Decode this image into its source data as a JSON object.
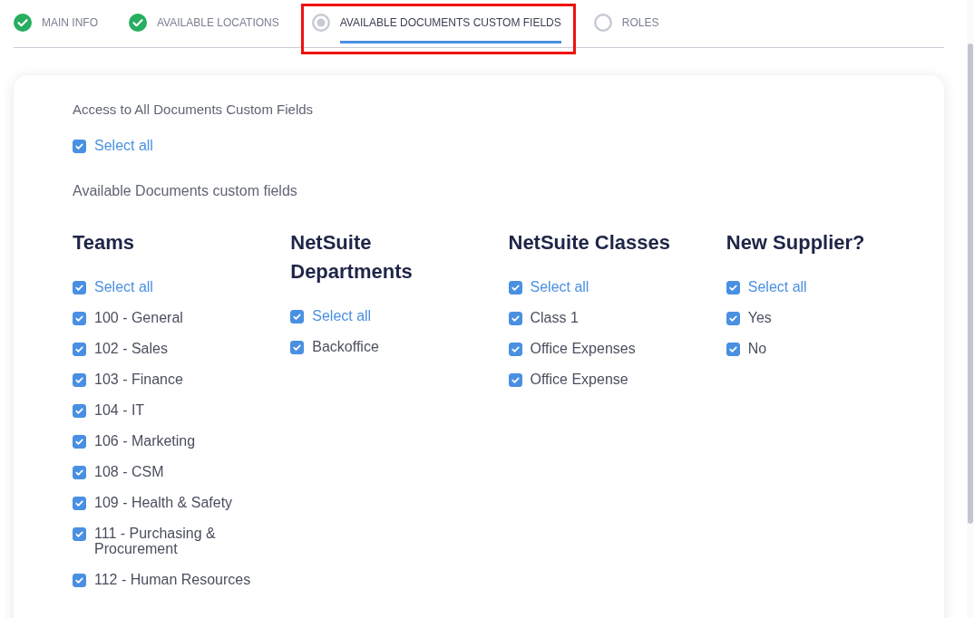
{
  "steps": [
    {
      "label": "MAIN INFO",
      "kind": "done",
      "selected": false,
      "highlighted": false
    },
    {
      "label": "AVAILABLE LOCATIONS",
      "kind": "done",
      "selected": false,
      "highlighted": false
    },
    {
      "label": "AVAILABLE DOCUMENTS CUSTOM FIELDS",
      "kind": "current",
      "selected": true,
      "highlighted": true
    },
    {
      "label": "ROLES",
      "kind": "pending",
      "selected": false,
      "highlighted": false
    }
  ],
  "access": {
    "title": "Access to All Documents Custom Fields",
    "select_all": {
      "label": "Select all",
      "checked": true
    }
  },
  "section_title": "Available Documents custom fields",
  "groups": [
    {
      "title": "Teams",
      "items": [
        {
          "label": "Select all",
          "kind": "select_all",
          "checked": true
        },
        {
          "label": "100 - General",
          "kind": "option",
          "checked": true
        },
        {
          "label": "102 - Sales",
          "kind": "option",
          "checked": true
        },
        {
          "label": "103 - Finance",
          "kind": "option",
          "checked": true
        },
        {
          "label": "104 - IT",
          "kind": "option",
          "checked": true
        },
        {
          "label": "106 - Marketing",
          "kind": "option",
          "checked": true
        },
        {
          "label": "108 - CSM",
          "kind": "option",
          "checked": true
        },
        {
          "label": "109 - Health & Safety",
          "kind": "option",
          "checked": true
        },
        {
          "label": "111 - Purchasing & Procurement",
          "kind": "option",
          "checked": true
        },
        {
          "label": "112 - Human Resources",
          "kind": "option",
          "checked": true
        }
      ]
    },
    {
      "title": "NetSuite Departments",
      "items": [
        {
          "label": "Select all",
          "kind": "select_all",
          "checked": true
        },
        {
          "label": "Backoffice",
          "kind": "option",
          "checked": true
        }
      ]
    },
    {
      "title": "NetSuite Classes",
      "items": [
        {
          "label": "Select all",
          "kind": "select_all",
          "checked": true
        },
        {
          "label": "Class 1",
          "kind": "option",
          "checked": true
        },
        {
          "label": "Office Expenses",
          "kind": "option",
          "checked": true
        },
        {
          "label": "Office Expense",
          "kind": "option",
          "checked": true
        }
      ]
    },
    {
      "title": "New Supplier?",
      "items": [
        {
          "label": "Select all",
          "kind": "select_all",
          "checked": true
        },
        {
          "label": "Yes",
          "kind": "option",
          "checked": true
        },
        {
          "label": "No",
          "kind": "option",
          "checked": true
        }
      ]
    }
  ]
}
